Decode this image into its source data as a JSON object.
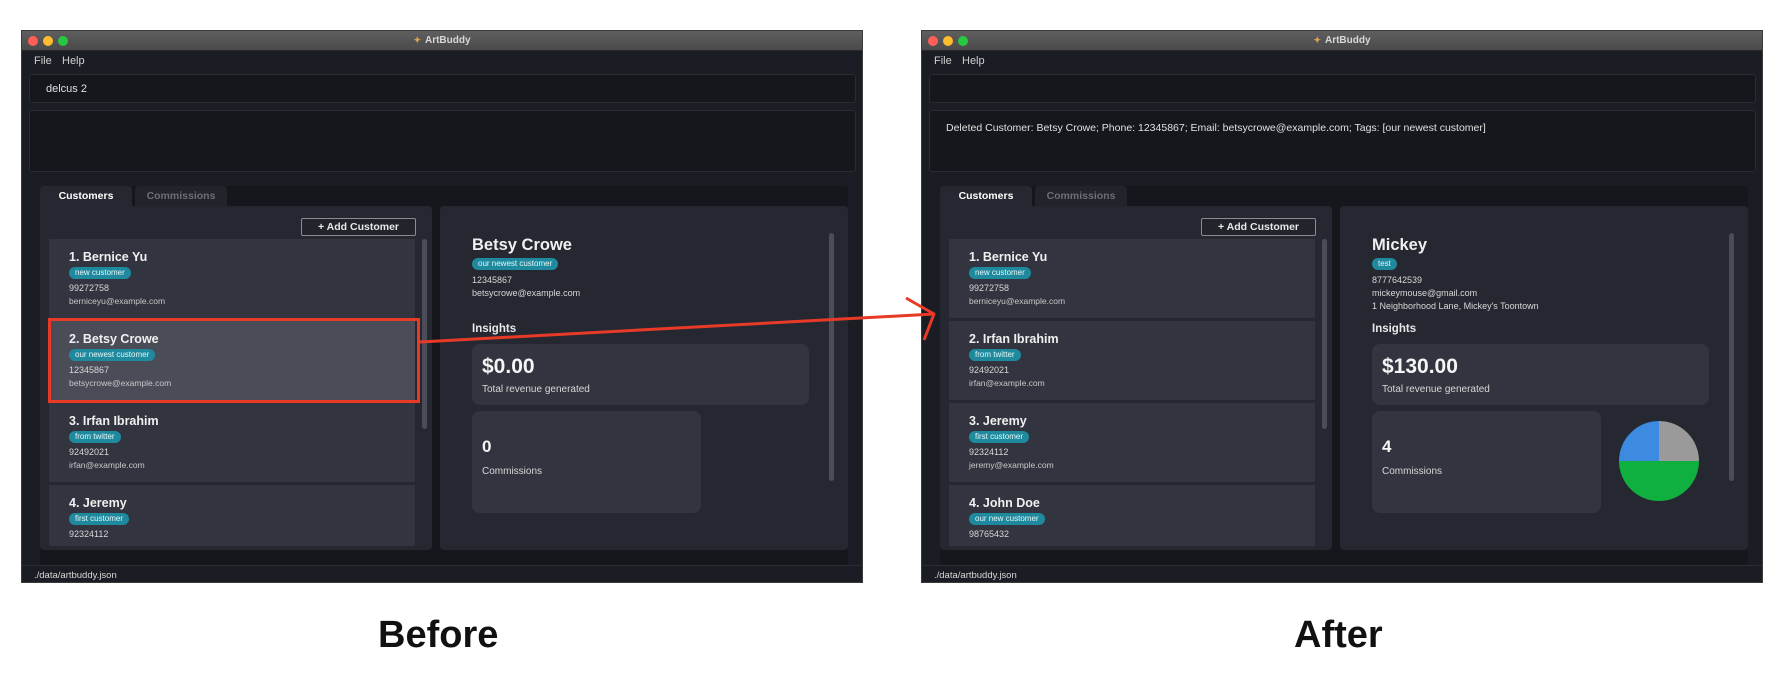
{
  "captions": {
    "before": "Before",
    "after": "After"
  },
  "colors": {
    "accent_highlight": "#e83a26",
    "tag_bg": "#1f8a9e",
    "window_bg": "#1b1d24",
    "pie_blue": "#3d8be0",
    "pie_gray": "#9a9a9a",
    "pie_green": "#10b040"
  },
  "before": {
    "window": {
      "title": "ArtBuddy",
      "app_icon": "palette-icon"
    },
    "menu": {
      "file": "File",
      "help": "Help"
    },
    "command": {
      "value": "delcus 2"
    },
    "result": {
      "text": ""
    },
    "tabs": {
      "customers": "Customers",
      "commissions": "Commissions"
    },
    "add_button": "+  Add Customer",
    "customers": [
      {
        "name": "1.  Bernice Yu",
        "tag": "new customer",
        "phone": "99272758",
        "email": "berniceyu@example.com"
      },
      {
        "name": "2.  Betsy Crowe",
        "tag": "our newest customer",
        "phone": "12345867",
        "email": "betsycrowe@example.com"
      },
      {
        "name": "3.  Irfan Ibrahim",
        "tag": "from twitter",
        "phone": "92492021",
        "email": "irfan@example.com"
      },
      {
        "name": "4.  Jeremy",
        "tag": "first customer",
        "phone": "92324112",
        "email": ""
      }
    ],
    "detail": {
      "name": "Betsy Crowe",
      "tag": "our newest customer",
      "phone": "12345867",
      "email": "betsycrowe@example.com",
      "address": "",
      "insights_label": "Insights",
      "revenue": "$0.00",
      "revenue_label": "Total revenue generated",
      "commissions": "0",
      "commissions_label": "Commissions"
    },
    "status": "./data/artbuddy.json"
  },
  "after": {
    "window": {
      "title": "ArtBuddy",
      "app_icon": "palette-icon"
    },
    "menu": {
      "file": "File",
      "help": "Help"
    },
    "command": {
      "value": ""
    },
    "result": {
      "text": "Deleted Customer: Betsy Crowe; Phone: 12345867; Email: betsycrowe@example.com; Tags: [our newest customer]"
    },
    "tabs": {
      "customers": "Customers",
      "commissions": "Commissions"
    },
    "add_button": "+  Add Customer",
    "customers": [
      {
        "name": "1.  Bernice Yu",
        "tag": "new customer",
        "phone": "99272758",
        "email": "berniceyu@example.com"
      },
      {
        "name": "2.  Irfan Ibrahim",
        "tag": "from twitter",
        "phone": "92492021",
        "email": "irfan@example.com"
      },
      {
        "name": "3.  Jeremy",
        "tag": "first customer",
        "phone": "92324112",
        "email": "jeremy@example.com"
      },
      {
        "name": "4.  John Doe",
        "tag": "our new customer",
        "phone": "98765432",
        "email": ""
      }
    ],
    "detail": {
      "name": "Mickey",
      "tag": "test",
      "phone": "8777642539",
      "email": "mickeymouse@gmail.com",
      "address": "1 Neighborhood Lane, Mickey's Toontown",
      "insights_label": "Insights",
      "revenue": "$130.00",
      "revenue_label": "Total revenue generated",
      "commissions": "4",
      "commissions_label": "Commissions",
      "pie_fractions": [
        0.25,
        0.25,
        0.5
      ]
    },
    "status": "./data/artbuddy.json"
  }
}
